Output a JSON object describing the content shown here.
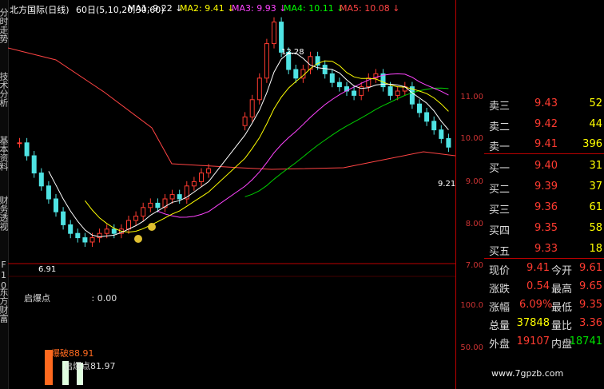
{
  "left_tabs": [
    "分时走势",
    "技术分析",
    "基本资料",
    "财务透视",
    "F10",
    "东方财富"
  ],
  "header": {
    "title": "北方国际(日线)",
    "period": "60日(5,10,20,30,60)",
    "ma": [
      {
        "label": "MA1: 9.22",
        "color": "#ffffff",
        "arrow": "↓"
      },
      {
        "label": "MA2: 9.41",
        "color": "#ffff00",
        "arrow": "↓"
      },
      {
        "label": "MA3: 9.93",
        "color": "#ff44ff",
        "arrow": "↓"
      },
      {
        "label": "MA4: 10.11",
        "color": "#00ff00",
        "arrow": "↓"
      },
      {
        "label": "MA5: 10.08",
        "color": "#ff4444",
        "arrow": "↓"
      }
    ]
  },
  "price_axis": [
    "11.00",
    "10.00",
    "9.00",
    "8.00",
    "7.00"
  ],
  "ind_axis": [
    "100.0",
    "50.00"
  ],
  "annotations": {
    "high": "12.28",
    "low": "6.91",
    "last": "9.21"
  },
  "indicator": {
    "name": "启爆点",
    "value": ": 0.00",
    "label1": "爆破88.91",
    "label2": "启爆点81.97"
  },
  "orderbook": {
    "sell": [
      {
        "label": "卖三",
        "price": "9.43",
        "qty": "52"
      },
      {
        "label": "卖二",
        "price": "9.42",
        "qty": "44"
      },
      {
        "label": "卖一",
        "price": "9.41",
        "qty": "396"
      }
    ],
    "buy": [
      {
        "label": "买一",
        "price": "9.40",
        "qty": "31"
      },
      {
        "label": "买二",
        "price": "9.39",
        "qty": "37"
      },
      {
        "label": "买三",
        "price": "9.36",
        "qty": "61"
      },
      {
        "label": "买四",
        "price": "9.35",
        "qty": "58"
      },
      {
        "label": "买五",
        "price": "9.33",
        "qty": "18"
      }
    ]
  },
  "quote": [
    {
      "l1": "现价",
      "v1": "9.41",
      "l2": "今开",
      "v2": "9.61"
    },
    {
      "l1": "涨跌",
      "v1": "0.54",
      "l2": "最高",
      "v2": "9.65"
    },
    {
      "l1": "涨幅",
      "v1": "6.09%",
      "l2": "最低",
      "v2": "9.35"
    },
    {
      "l1": "总量",
      "v1": "37848",
      "l2": "量比",
      "v2": "3.36"
    },
    {
      "l1": "外盘",
      "v1": "19107",
      "l2": "内盘",
      "v2": "18741"
    }
  ],
  "watermark": "www.7gpzb.com",
  "colors": {
    "up": "#ff3b30",
    "down": "#4fe3e3",
    "axis": "#cc2222"
  }
}
